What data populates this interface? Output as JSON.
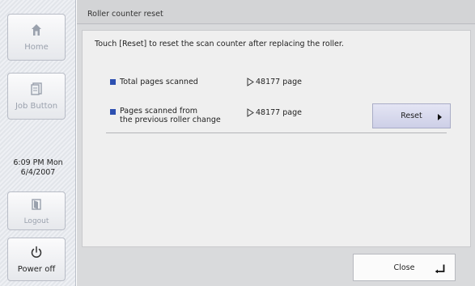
{
  "sidebar": {
    "home_label": "Home",
    "job_button_label": "Job Button",
    "clock_time": "6:09 PM  Mon",
    "clock_date": "6/4/2007",
    "logout_label": "Logout",
    "power_off_label": "Power off"
  },
  "main": {
    "title": "Roller counter reset",
    "instruction": "Touch [Reset] to reset the scan counter after replacing the roller.",
    "rows": [
      {
        "label_line1": "Total pages scanned",
        "label_line2": "",
        "value": "48177 page"
      },
      {
        "label_line1": "Pages scanned from",
        "label_line2": "the previous roller change",
        "value": "48177 page"
      }
    ],
    "reset_label": "Reset",
    "close_label": "Close"
  },
  "colors": {
    "bullet": "#2c4fb0",
    "reset_button": "#cdcfe7",
    "panel_background": "#d9dadc",
    "sidebar_pattern": "#e2e5ea"
  },
  "icons": [
    "home-icon",
    "job-button-icon",
    "logout-icon",
    "power-icon",
    "play-icon",
    "enter-icon"
  ]
}
